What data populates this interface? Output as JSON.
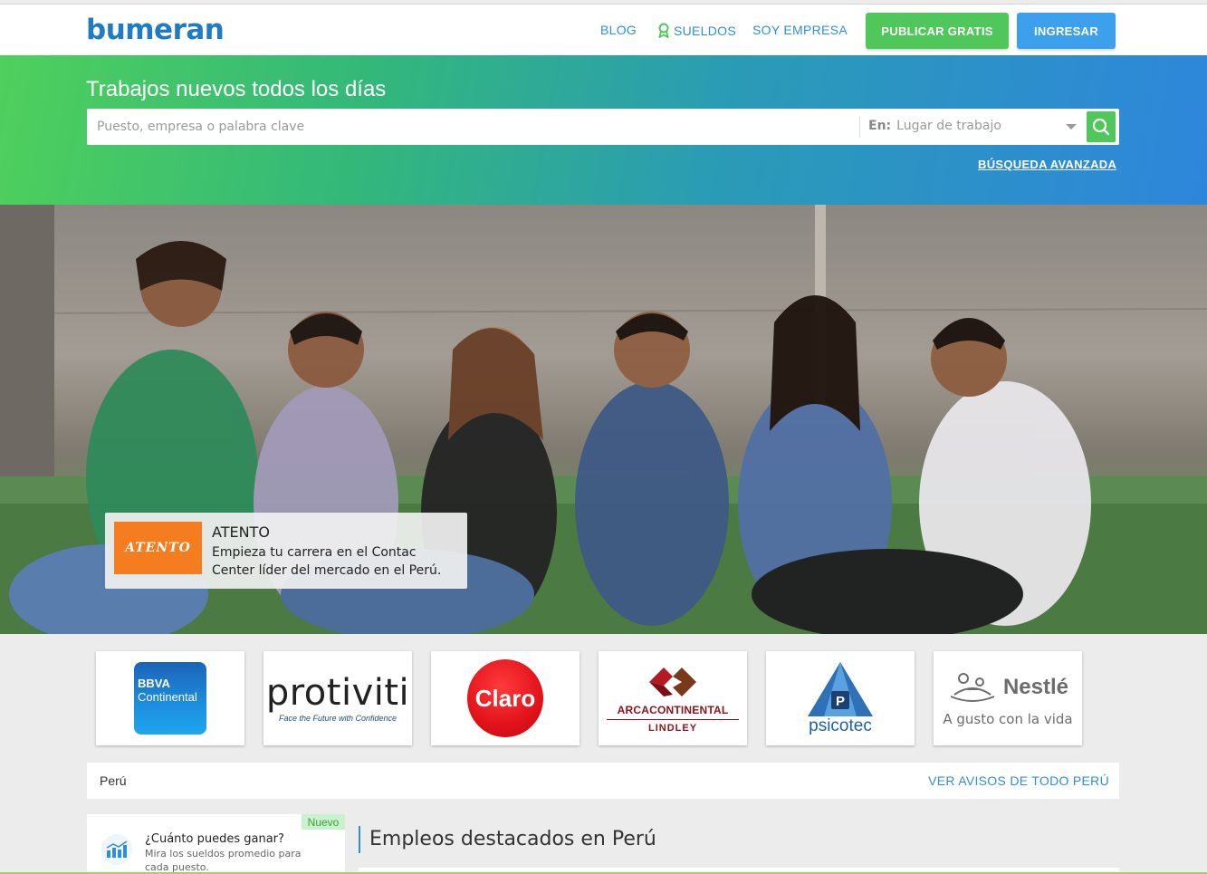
{
  "header": {
    "logo": "bumeran",
    "nav": {
      "blog": "BLOG",
      "sueldos": "SUELDOS",
      "empresa": "SOY EMPRESA"
    },
    "publicar_label": "PUBLICAR GRATIS",
    "ingresar_label": "INGRESAR"
  },
  "search": {
    "title": "Trabajos nuevos todos los días",
    "placeholder": "Puesto, empresa o palabra clave",
    "location_prefix": "En:",
    "location_placeholder": "Lugar de trabajo",
    "advanced_label": "BÚSQUEDA AVANZADA"
  },
  "hero": {
    "promo": {
      "logo_text": "ATENTO",
      "title": "ATENTO",
      "description": "Empieza tu carrera en el Contac Center líder del mercado en el Perú."
    }
  },
  "companies": {
    "bbva_line1": "BBVA",
    "bbva_line2": "Continental",
    "protiviti_name": "protiviti",
    "protiviti_tagline": "Face the Future with Confidence",
    "claro_name": "Claro",
    "arca_name": "ARCACONTINENTAL",
    "arca_sub": "LINDLEY",
    "psicotec_name": "psicotec",
    "nestle_name": "Nestlé",
    "nestle_tagline": "A gusto con la vida"
  },
  "region": {
    "label": "Perú",
    "link": "VER AVISOS DE TODO PERÚ"
  },
  "salary_card": {
    "badge": "Nuevo",
    "title": "¿Cuánto puedes ganar?",
    "description": "Mira los sueldos promedio para cada puesto."
  },
  "featured": {
    "title": "Empleos destacados en Perú"
  },
  "colors": {
    "brand_blue": "#1f7cc4",
    "link_blue": "#2e8fd8",
    "green": "#4fc75a",
    "ingresar_blue": "#3da0ec",
    "atento_orange": "#f57c1f"
  }
}
